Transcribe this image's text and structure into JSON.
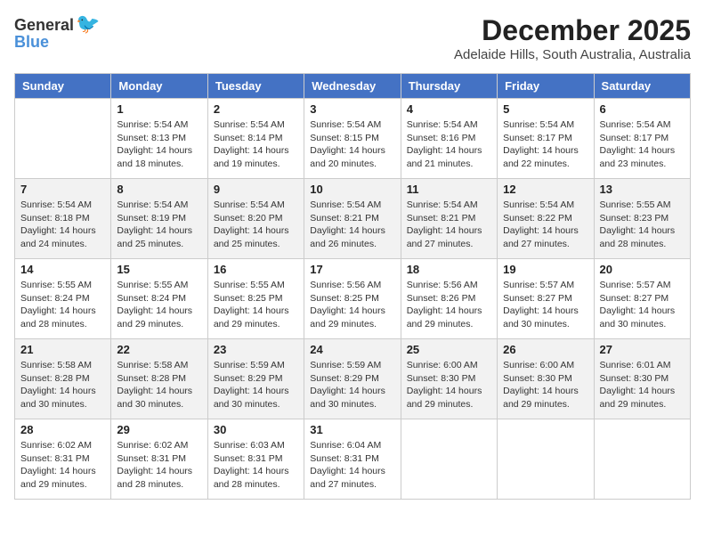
{
  "header": {
    "logo_general": "General",
    "logo_blue": "Blue",
    "month_title": "December 2025",
    "location": "Adelaide Hills, South Australia, Australia"
  },
  "weekdays": [
    "Sunday",
    "Monday",
    "Tuesday",
    "Wednesday",
    "Thursday",
    "Friday",
    "Saturday"
  ],
  "weeks": [
    [
      {
        "day": "",
        "info": ""
      },
      {
        "day": "1",
        "info": "Sunrise: 5:54 AM\nSunset: 8:13 PM\nDaylight: 14 hours\nand 18 minutes."
      },
      {
        "day": "2",
        "info": "Sunrise: 5:54 AM\nSunset: 8:14 PM\nDaylight: 14 hours\nand 19 minutes."
      },
      {
        "day": "3",
        "info": "Sunrise: 5:54 AM\nSunset: 8:15 PM\nDaylight: 14 hours\nand 20 minutes."
      },
      {
        "day": "4",
        "info": "Sunrise: 5:54 AM\nSunset: 8:16 PM\nDaylight: 14 hours\nand 21 minutes."
      },
      {
        "day": "5",
        "info": "Sunrise: 5:54 AM\nSunset: 8:17 PM\nDaylight: 14 hours\nand 22 minutes."
      },
      {
        "day": "6",
        "info": "Sunrise: 5:54 AM\nSunset: 8:17 PM\nDaylight: 14 hours\nand 23 minutes."
      }
    ],
    [
      {
        "day": "7",
        "info": "Sunrise: 5:54 AM\nSunset: 8:18 PM\nDaylight: 14 hours\nand 24 minutes."
      },
      {
        "day": "8",
        "info": "Sunrise: 5:54 AM\nSunset: 8:19 PM\nDaylight: 14 hours\nand 25 minutes."
      },
      {
        "day": "9",
        "info": "Sunrise: 5:54 AM\nSunset: 8:20 PM\nDaylight: 14 hours\nand 25 minutes."
      },
      {
        "day": "10",
        "info": "Sunrise: 5:54 AM\nSunset: 8:21 PM\nDaylight: 14 hours\nand 26 minutes."
      },
      {
        "day": "11",
        "info": "Sunrise: 5:54 AM\nSunset: 8:21 PM\nDaylight: 14 hours\nand 27 minutes."
      },
      {
        "day": "12",
        "info": "Sunrise: 5:54 AM\nSunset: 8:22 PM\nDaylight: 14 hours\nand 27 minutes."
      },
      {
        "day": "13",
        "info": "Sunrise: 5:55 AM\nSunset: 8:23 PM\nDaylight: 14 hours\nand 28 minutes."
      }
    ],
    [
      {
        "day": "14",
        "info": "Sunrise: 5:55 AM\nSunset: 8:24 PM\nDaylight: 14 hours\nand 28 minutes."
      },
      {
        "day": "15",
        "info": "Sunrise: 5:55 AM\nSunset: 8:24 PM\nDaylight: 14 hours\nand 29 minutes."
      },
      {
        "day": "16",
        "info": "Sunrise: 5:55 AM\nSunset: 8:25 PM\nDaylight: 14 hours\nand 29 minutes."
      },
      {
        "day": "17",
        "info": "Sunrise: 5:56 AM\nSunset: 8:25 PM\nDaylight: 14 hours\nand 29 minutes."
      },
      {
        "day": "18",
        "info": "Sunrise: 5:56 AM\nSunset: 8:26 PM\nDaylight: 14 hours\nand 29 minutes."
      },
      {
        "day": "19",
        "info": "Sunrise: 5:57 AM\nSunset: 8:27 PM\nDaylight: 14 hours\nand 30 minutes."
      },
      {
        "day": "20",
        "info": "Sunrise: 5:57 AM\nSunset: 8:27 PM\nDaylight: 14 hours\nand 30 minutes."
      }
    ],
    [
      {
        "day": "21",
        "info": "Sunrise: 5:58 AM\nSunset: 8:28 PM\nDaylight: 14 hours\nand 30 minutes."
      },
      {
        "day": "22",
        "info": "Sunrise: 5:58 AM\nSunset: 8:28 PM\nDaylight: 14 hours\nand 30 minutes."
      },
      {
        "day": "23",
        "info": "Sunrise: 5:59 AM\nSunset: 8:29 PM\nDaylight: 14 hours\nand 30 minutes."
      },
      {
        "day": "24",
        "info": "Sunrise: 5:59 AM\nSunset: 8:29 PM\nDaylight: 14 hours\nand 30 minutes."
      },
      {
        "day": "25",
        "info": "Sunrise: 6:00 AM\nSunset: 8:30 PM\nDaylight: 14 hours\nand 29 minutes."
      },
      {
        "day": "26",
        "info": "Sunrise: 6:00 AM\nSunset: 8:30 PM\nDaylight: 14 hours\nand 29 minutes."
      },
      {
        "day": "27",
        "info": "Sunrise: 6:01 AM\nSunset: 8:30 PM\nDaylight: 14 hours\nand 29 minutes."
      }
    ],
    [
      {
        "day": "28",
        "info": "Sunrise: 6:02 AM\nSunset: 8:31 PM\nDaylight: 14 hours\nand 29 minutes."
      },
      {
        "day": "29",
        "info": "Sunrise: 6:02 AM\nSunset: 8:31 PM\nDaylight: 14 hours\nand 28 minutes."
      },
      {
        "day": "30",
        "info": "Sunrise: 6:03 AM\nSunset: 8:31 PM\nDaylight: 14 hours\nand 28 minutes."
      },
      {
        "day": "31",
        "info": "Sunrise: 6:04 AM\nSunset: 8:31 PM\nDaylight: 14 hours\nand 27 minutes."
      },
      {
        "day": "",
        "info": ""
      },
      {
        "day": "",
        "info": ""
      },
      {
        "day": "",
        "info": ""
      }
    ]
  ]
}
